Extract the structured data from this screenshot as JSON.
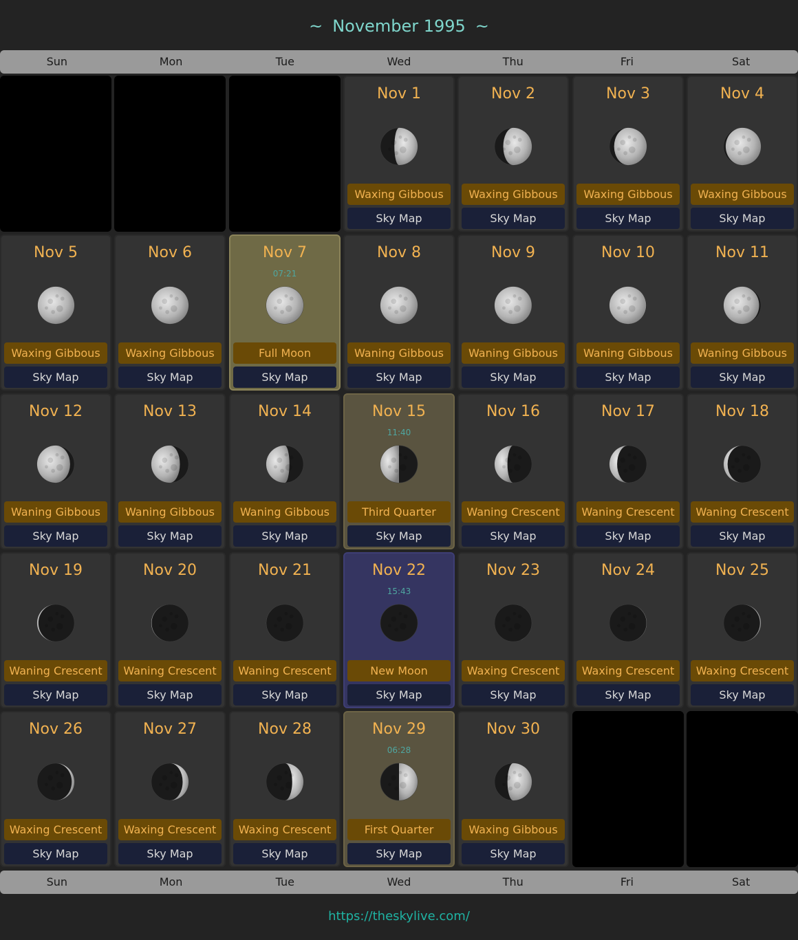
{
  "title": {
    "prefix": "~",
    "text": "November 1995",
    "suffix": "~"
  },
  "weekdays": [
    "Sun",
    "Mon",
    "Tue",
    "Wed",
    "Thu",
    "Fri",
    "Sat"
  ],
  "sky_map_label": "Sky Map",
  "colors": {
    "background": "#232323",
    "title": "#7fd6cc",
    "date": "#f1b251",
    "phase_bg": "#6a4a06",
    "skymap_bg": "#1a2038",
    "link": "#1fb3a3"
  },
  "leading_empty": 3,
  "days": [
    {
      "date": "Nov 1",
      "phase": "Waxing Gibbous",
      "illum": 0.58,
      "waxing": true
    },
    {
      "date": "Nov 2",
      "phase": "Waxing Gibbous",
      "illum": 0.68,
      "waxing": true
    },
    {
      "date": "Nov 3",
      "phase": "Waxing Gibbous",
      "illum": 0.77,
      "waxing": true
    },
    {
      "date": "Nov 4",
      "phase": "Waxing Gibbous",
      "illum": 0.85,
      "waxing": true
    },
    {
      "date": "Nov 5",
      "phase": "Waxing Gibbous",
      "illum": 0.92,
      "waxing": true
    },
    {
      "date": "Nov 6",
      "phase": "Waxing Gibbous",
      "illum": 0.97,
      "waxing": true
    },
    {
      "date": "Nov 7",
      "phase": "Full Moon",
      "illum": 1.0,
      "waxing": true,
      "time": "07:21",
      "highlight": "full"
    },
    {
      "date": "Nov 8",
      "phase": "Waning Gibbous",
      "illum": 0.99,
      "waxing": false
    },
    {
      "date": "Nov 9",
      "phase": "Waning Gibbous",
      "illum": 0.96,
      "waxing": false
    },
    {
      "date": "Nov 10",
      "phase": "Waning Gibbous",
      "illum": 0.92,
      "waxing": false
    },
    {
      "date": "Nov 11",
      "phase": "Waning Gibbous",
      "illum": 0.86,
      "waxing": false
    },
    {
      "date": "Nov 12",
      "phase": "Waning Gibbous",
      "illum": 0.78,
      "waxing": false
    },
    {
      "date": "Nov 13",
      "phase": "Waning Gibbous",
      "illum": 0.68,
      "waxing": false
    },
    {
      "date": "Nov 14",
      "phase": "Waning Gibbous",
      "illum": 0.58,
      "waxing": false
    },
    {
      "date": "Nov 15",
      "phase": "Third Quarter",
      "illum": 0.5,
      "waxing": false,
      "time": "11:40",
      "highlight": "quarter"
    },
    {
      "date": "Nov 16",
      "phase": "Waning Crescent",
      "illum": 0.4,
      "waxing": false
    },
    {
      "date": "Nov 17",
      "phase": "Waning Crescent",
      "illum": 0.3,
      "waxing": false
    },
    {
      "date": "Nov 18",
      "phase": "Waning Crescent",
      "illum": 0.21,
      "waxing": false
    },
    {
      "date": "Nov 19",
      "phase": "Waning Crescent",
      "illum": 0.12,
      "waxing": false
    },
    {
      "date": "Nov 20",
      "phase": "Waning Crescent",
      "illum": 0.06,
      "waxing": false
    },
    {
      "date": "Nov 21",
      "phase": "Waning Crescent",
      "illum": 0.02,
      "waxing": false
    },
    {
      "date": "Nov 22",
      "phase": "New Moon",
      "illum": 0.0,
      "waxing": true,
      "time": "15:43",
      "highlight": "new"
    },
    {
      "date": "Nov 23",
      "phase": "Waxing Crescent",
      "illum": 0.02,
      "waxing": true
    },
    {
      "date": "Nov 24",
      "phase": "Waxing Crescent",
      "illum": 0.05,
      "waxing": true
    },
    {
      "date": "Nov 25",
      "phase": "Waxing Crescent",
      "illum": 0.1,
      "waxing": true
    },
    {
      "date": "Nov 26",
      "phase": "Waxing Crescent",
      "illum": 0.17,
      "waxing": true
    },
    {
      "date": "Nov 27",
      "phase": "Waxing Crescent",
      "illum": 0.26,
      "waxing": true
    },
    {
      "date": "Nov 28",
      "phase": "Waxing Crescent",
      "illum": 0.37,
      "waxing": true
    },
    {
      "date": "Nov 29",
      "phase": "First Quarter",
      "illum": 0.5,
      "waxing": true,
      "time": "06:28",
      "highlight": "quarter"
    },
    {
      "date": "Nov 30",
      "phase": "Waxing Gibbous",
      "illum": 0.6,
      "waxing": true
    }
  ],
  "footer": {
    "link_text": "https://theskylive.com/"
  }
}
